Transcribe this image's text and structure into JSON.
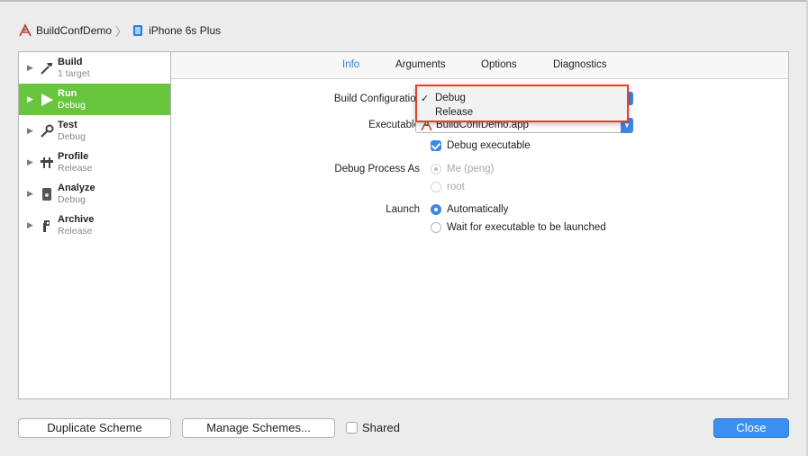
{
  "breadcrumb": {
    "project": "BuildConfDemo",
    "device": "iPhone 6s Plus"
  },
  "sidebar": {
    "items": [
      {
        "title": "Build",
        "sub": "1 target",
        "icon": "hammer-icon"
      },
      {
        "title": "Run",
        "sub": "Debug",
        "icon": "play-icon"
      },
      {
        "title": "Test",
        "sub": "Debug",
        "icon": "wrench-icon"
      },
      {
        "title": "Profile",
        "sub": "Release",
        "icon": "instruments-icon"
      },
      {
        "title": "Analyze",
        "sub": "Debug",
        "icon": "analyze-icon"
      },
      {
        "title": "Archive",
        "sub": "Release",
        "icon": "archive-icon"
      }
    ]
  },
  "tabs": {
    "info": "Info",
    "arguments": "Arguments",
    "options": "Options",
    "diagnostics": "Diagnostics"
  },
  "form": {
    "build_configuration_label": "Build Configuration",
    "executable_label": "Executable",
    "executable_value": "BuildConfDemo.app",
    "debug_executable_label": "Debug executable",
    "debug_process_as_label": "Debug Process As",
    "debug_process_me": "Me (peng)",
    "debug_process_root": "root",
    "launch_label": "Launch",
    "launch_automatically": "Automatically",
    "launch_wait": "Wait for executable to be launched"
  },
  "popup_menu": {
    "items": [
      "Debug",
      "Release"
    ],
    "checkmark": "✓"
  },
  "footer": {
    "duplicate_scheme": "Duplicate Scheme",
    "manage_schemes": "Manage Schemes...",
    "shared": "Shared",
    "close": "Close"
  },
  "colors": {
    "selected_bg": "#68c53e",
    "accent": "#3b86e6",
    "highlight_border": "#e4402d"
  }
}
